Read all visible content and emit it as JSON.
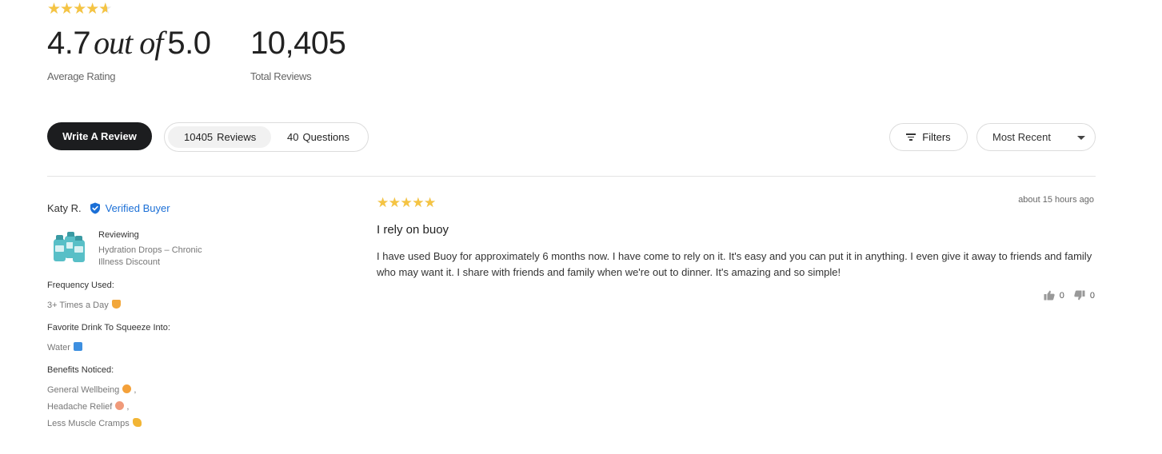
{
  "summary": {
    "average_rating": 4.7,
    "average_value": "4.7",
    "out_of_text": "out of",
    "max_value": "5.0",
    "average_label": "Average Rating",
    "total_reviews": "10,405",
    "total_label": "Total Reviews"
  },
  "actions": {
    "write_review_label": "Write A Review",
    "tabs": [
      {
        "count": "10405",
        "label": "Reviews",
        "active": true
      },
      {
        "count": "40",
        "label": "Questions",
        "active": false
      }
    ],
    "filters_label": "Filters",
    "sort_selected": "Most Recent"
  },
  "review": {
    "reviewer_name": "Katy R.",
    "verified_label": "Verified Buyer",
    "reviewing_label": "Reviewing",
    "product_name": "Hydration Drops – Chronic Illness Discount",
    "attributes": [
      {
        "label": "Frequency Used:",
        "values": [
          "3+ Times a Day"
        ]
      },
      {
        "label": "Favorite Drink To Squeeze Into:",
        "values": [
          "Water"
        ]
      },
      {
        "label": "Benefits Noticed:",
        "values": [
          "General Wellbeing",
          "Headache Relief",
          "Less Muscle Cramps"
        ]
      }
    ],
    "rating": 5,
    "date": "about 15 hours ago",
    "title": "I rely on buoy",
    "body": "I have used Buoy for approximately 6 months now. I have come to rely on it. It's easy and you can put it in anything. I even give it away to friends and family who may want it. I share with friends and family when we're out to dinner. It's amazing and so simple!",
    "helpful_count": "0",
    "unhelpful_count": "0"
  },
  "colors": {
    "star": "#f5c443",
    "accent_blue": "#1b6fd6",
    "button_dark": "#1c1d1f"
  }
}
